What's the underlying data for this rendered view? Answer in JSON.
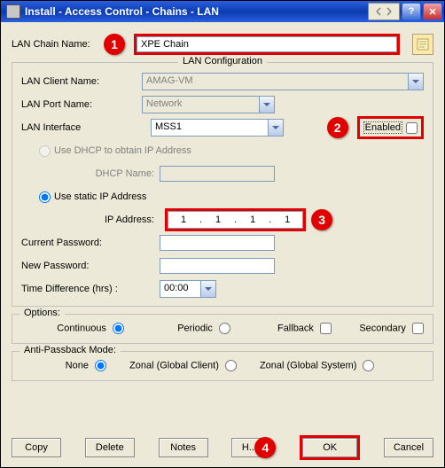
{
  "title": "Install - Access Control - Chains - LAN",
  "labels": {
    "chain_name": "LAN Chain Name:",
    "lan_config": "LAN Configuration",
    "client_name": "LAN Client Name:",
    "port_name": "LAN Port Name:",
    "interface": "LAN Interface",
    "enabled": "Enabled",
    "dhcp_radio": "Use DHCP to obtain IP Address",
    "dhcp_name": "DHCP Name:",
    "static_radio": "Use static IP Address",
    "ip_address": "IP Address:",
    "current_pw": "Current Password:",
    "new_pw": "New Password:",
    "time_diff": "Time Difference (hrs) :",
    "options": "Options:",
    "continuous": "Continuous",
    "periodic": "Periodic",
    "fallback": "Fallback",
    "secondary": "Secondary",
    "antipassback": "Anti-Passback Mode:",
    "none": "None",
    "zonal_client": "Zonal (Global Client)",
    "zonal_system": "Zonal (Global System)",
    "more": "..."
  },
  "values": {
    "chain_name": "XPE Chain",
    "client_name": "AMAG-VM",
    "port_name": "Network",
    "interface": "MSS1",
    "time_diff_sel": "00:00",
    "ip": {
      "a": "1",
      "b": "1",
      "c": "1",
      "d": "1"
    }
  },
  "buttons": {
    "copy": "Copy",
    "delete": "Delete",
    "notes": "Notes",
    "help": "Help",
    "ok": "OK",
    "cancel": "Cancel"
  },
  "badges": {
    "one": "1",
    "two": "2",
    "three": "3",
    "four": "4"
  }
}
